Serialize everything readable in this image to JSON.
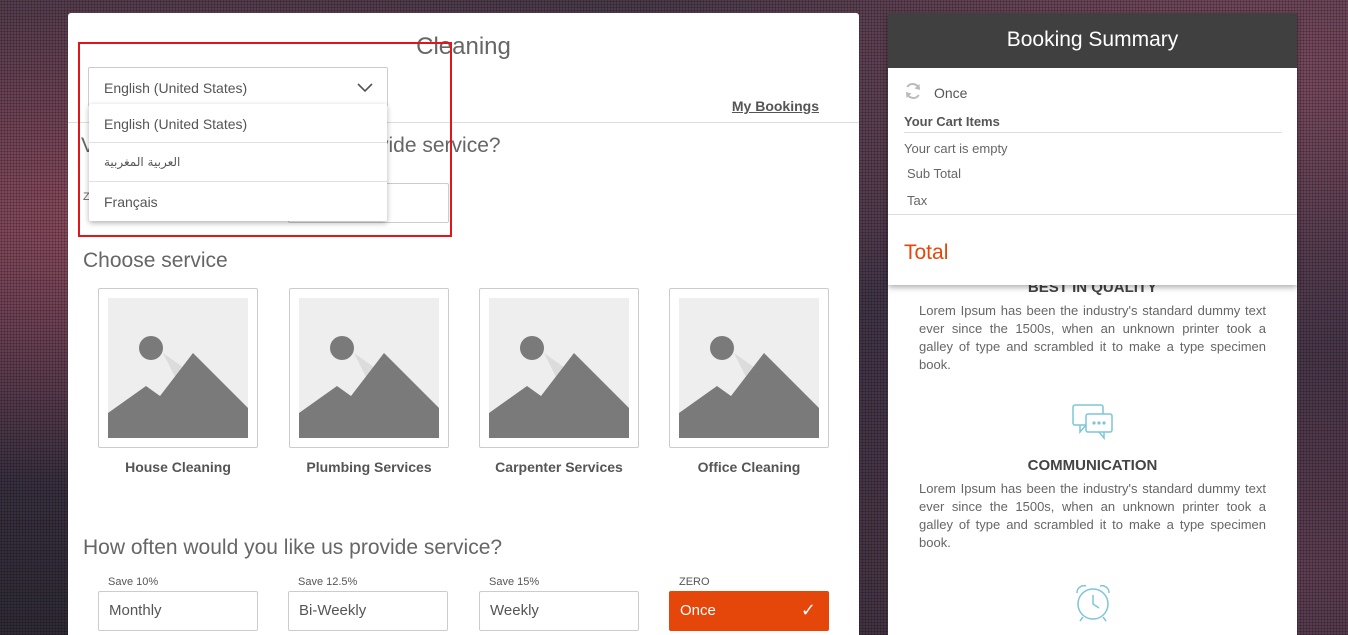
{
  "main": {
    "title": "Cleaning",
    "my_bookings": "My Bookings",
    "partial_heading": "vide service?",
    "zip_hint": "Z",
    "choose_heading": "Choose service",
    "services": [
      {
        "name": "House Cleaning",
        "icon": "image-placeholder-icon"
      },
      {
        "name": "Plumbing Services",
        "icon": "image-placeholder-icon"
      },
      {
        "name": "Carpenter Services",
        "icon": "image-placeholder-icon"
      },
      {
        "name": "Office Cleaning",
        "icon": "image-placeholder-icon"
      }
    ],
    "often_heading": "How often would you like us provide service?",
    "frequencies": [
      {
        "save": "Save 10%",
        "label": "Monthly"
      },
      {
        "save": "Save 12.5%",
        "label": "Bi-Weekly"
      },
      {
        "save": "Save 15%",
        "label": "Weekly"
      },
      {
        "save": "ZERO",
        "label": "Once",
        "selected": true
      }
    ],
    "check_glyph": "✓"
  },
  "language": {
    "selected": "English (United States)",
    "options": [
      "English (United States)",
      "العربية المغربية",
      "Français"
    ]
  },
  "summary": {
    "title": "Booking Summary",
    "frequency": "Once",
    "cart_title": "Your Cart Items",
    "cart_empty": "Your cart is empty",
    "subtotal_label": "Sub Total",
    "tax_label": "Tax",
    "total_label": "Total"
  },
  "features": [
    {
      "title": "BEST IN QUALITY",
      "text": "Lorem Ipsum has been the industry's standard dummy text ever since the 1500s, when an unknown printer took a galley of type and scrambled it to make a type specimen book."
    },
    {
      "title": "COMMUNICATION",
      "text": "Lorem Ipsum has been the industry's standard dummy text ever since the 1500s, when an unknown printer took a galley of type and scrambled it to make a type specimen book.",
      "icon": "chat-bubbles-icon"
    },
    {
      "icon": "alarm-clock-icon"
    }
  ],
  "colors": {
    "accent": "#e5460a",
    "header_dark": "#404040",
    "highlight": "#e0161b"
  }
}
